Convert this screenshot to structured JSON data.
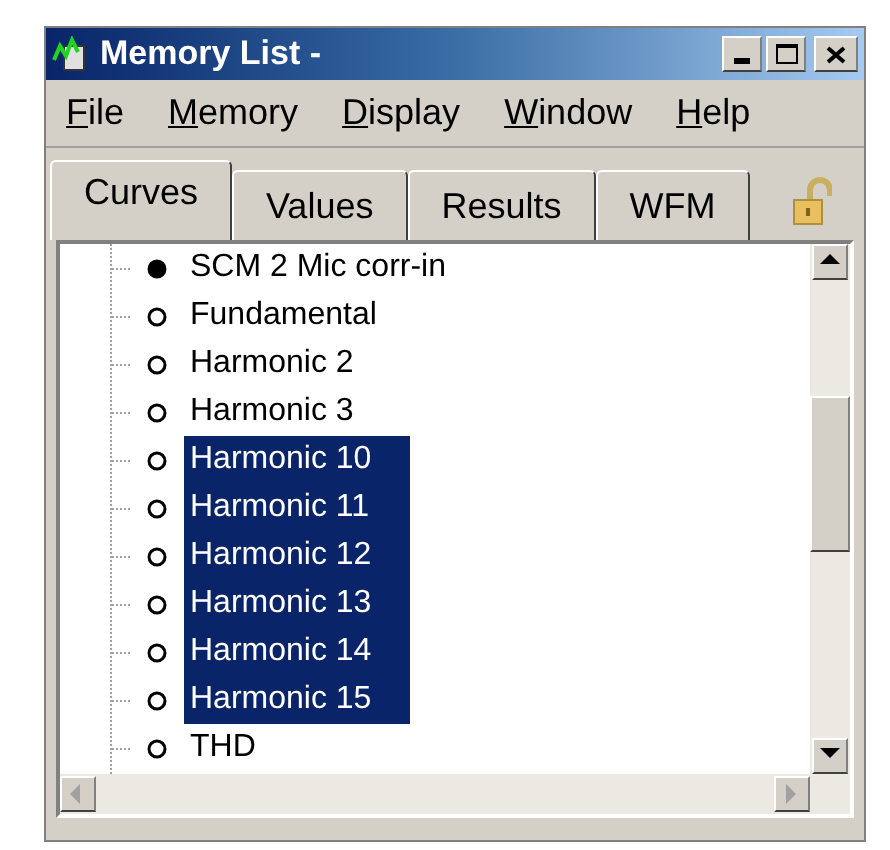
{
  "window": {
    "title": "Memory List -"
  },
  "menu": [
    "File",
    "Memory",
    "Display",
    "Window",
    "Help"
  ],
  "tabs": [
    {
      "label": "Curves",
      "selected": true
    },
    {
      "label": "Values",
      "selected": false
    },
    {
      "label": "Results",
      "selected": false
    },
    {
      "label": "WFM",
      "selected": false
    }
  ],
  "lock": {
    "locked": false
  },
  "tree": {
    "items": [
      {
        "label": "SCM 2 Mic corr-in",
        "filled": true,
        "selected": false
      },
      {
        "label": "Fundamental",
        "filled": false,
        "selected": false
      },
      {
        "label": "Harmonic 2",
        "filled": false,
        "selected": false
      },
      {
        "label": "Harmonic 3",
        "filled": false,
        "selected": false
      },
      {
        "label": "Harmonic 10",
        "filled": false,
        "selected": true
      },
      {
        "label": "Harmonic 11",
        "filled": false,
        "selected": true
      },
      {
        "label": "Harmonic 12",
        "filled": false,
        "selected": true
      },
      {
        "label": "Harmonic 13",
        "filled": false,
        "selected": true
      },
      {
        "label": "Harmonic 14",
        "filled": false,
        "selected": true
      },
      {
        "label": "Harmonic 15",
        "filled": false,
        "selected": true
      },
      {
        "label": "THD",
        "filled": false,
        "selected": false
      }
    ]
  }
}
